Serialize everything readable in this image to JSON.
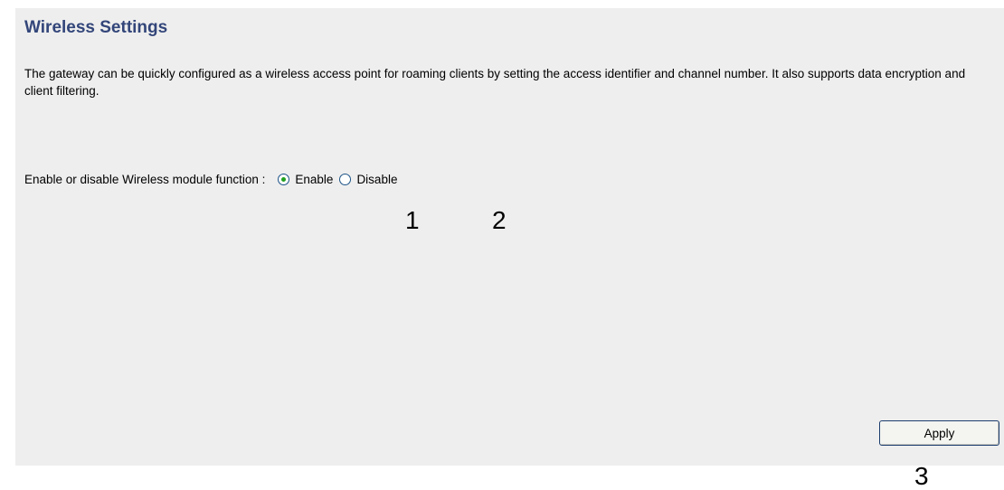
{
  "page": {
    "title": "Wireless Settings",
    "description": "The gateway can be quickly configured as a wireless access point for roaming clients by setting the access identifier and channel number. It also supports data encryption and client filtering."
  },
  "wireless_module": {
    "label": "Enable or disable Wireless module function :",
    "options": [
      {
        "label": "Enable",
        "selected": true
      },
      {
        "label": "Disable",
        "selected": false
      }
    ]
  },
  "actions": {
    "apply_label": "Apply"
  },
  "callouts": [
    "1",
    "2",
    "3"
  ],
  "colors": {
    "title": "#33467a",
    "panel_background": "#eeeeee",
    "radio_selected": "#21a121",
    "radio_border": "#1d5387",
    "button_border": "#1c3d6e"
  }
}
